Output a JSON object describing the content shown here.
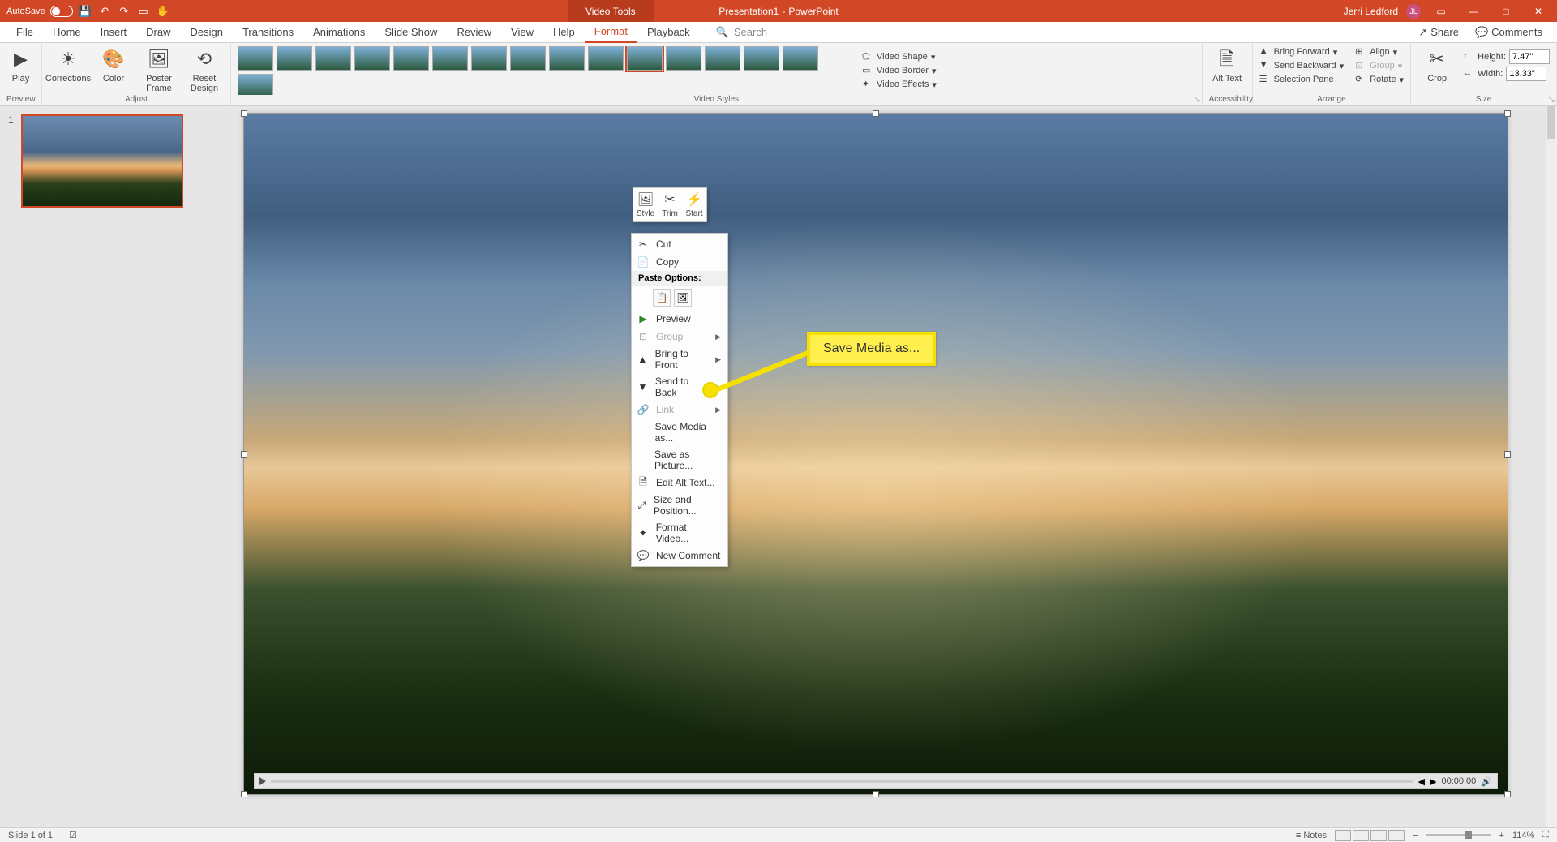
{
  "title_bar": {
    "autosave_label": "AutoSave",
    "autosave_state": "Off",
    "doc_name": "Presentation1",
    "app_name": "PowerPoint",
    "tool_tab": "Video Tools",
    "user_name": "Jerri Ledford",
    "user_initials": "JL"
  },
  "tabs": {
    "items": [
      "File",
      "Home",
      "Insert",
      "Draw",
      "Design",
      "Transitions",
      "Animations",
      "Slide Show",
      "Review",
      "View",
      "Help",
      "Format",
      "Playback"
    ],
    "active": "Format",
    "search_placeholder": "Search",
    "share": "Share",
    "comments": "Comments"
  },
  "ribbon": {
    "preview": {
      "play": "Play",
      "label": "Preview"
    },
    "adjust": {
      "corrections": "Corrections",
      "color": "Color",
      "poster_frame": "Poster Frame",
      "reset_design": "Reset Design",
      "label": "Adjust"
    },
    "video_styles_label": "Video Styles",
    "shape": "Video Shape",
    "border": "Video Border",
    "effects": "Video Effects",
    "accessibility": {
      "alt_text": "Alt Text",
      "label": "Accessibility"
    },
    "arrange": {
      "bring_forward": "Bring Forward",
      "send_backward": "Send Backward",
      "selection_pane": "Selection Pane",
      "align": "Align",
      "group": "Group",
      "rotate": "Rotate",
      "label": "Arrange"
    },
    "size": {
      "crop": "Crop",
      "height_label": "Height:",
      "height_value": "7.47\"",
      "width_label": "Width:",
      "width_value": "13.33\"",
      "label": "Size"
    }
  },
  "slides": {
    "current_number": "1"
  },
  "mini_toolbar": {
    "style": "Style",
    "trim": "Trim",
    "start": "Start"
  },
  "context_menu": {
    "cut": "Cut",
    "copy": "Copy",
    "paste_options": "Paste Options:",
    "preview": "Preview",
    "group": "Group",
    "bring_to_front": "Bring to Front",
    "send_to_back": "Send to Back",
    "link": "Link",
    "save_media_as": "Save Media as...",
    "save_as_picture": "Save as Picture...",
    "edit_alt_text": "Edit Alt Text...",
    "size_and_position": "Size and Position...",
    "format_video": "Format Video...",
    "new_comment": "New Comment"
  },
  "callout": {
    "text": "Save Media as..."
  },
  "video_controls": {
    "time": "00:00.00"
  },
  "status": {
    "slide_info": "Slide 1 of 1",
    "notes": "Notes",
    "zoom": "114%"
  }
}
